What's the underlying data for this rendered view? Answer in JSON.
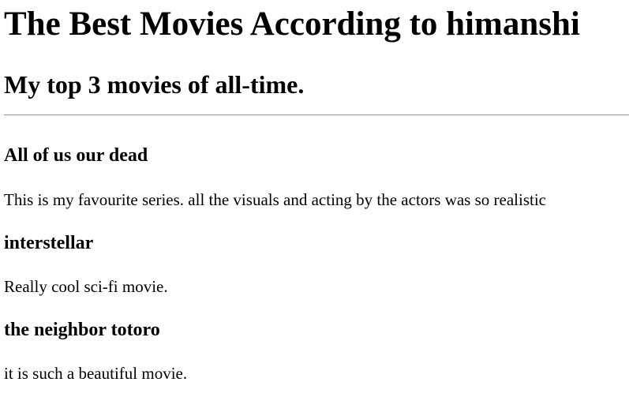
{
  "page": {
    "title": "The Best Movies According to himanshi",
    "subtitle": "My top 3 movies of all-time."
  },
  "movies": [
    {
      "name": "All of us our dead",
      "description": "This is my favourite series. all the visuals and acting by the actors was so realistic"
    },
    {
      "name": "interstellar",
      "description": "Really cool sci-fi movie."
    },
    {
      "name": "the neighbor totoro",
      "description": "it is such a beautiful movie."
    }
  ]
}
